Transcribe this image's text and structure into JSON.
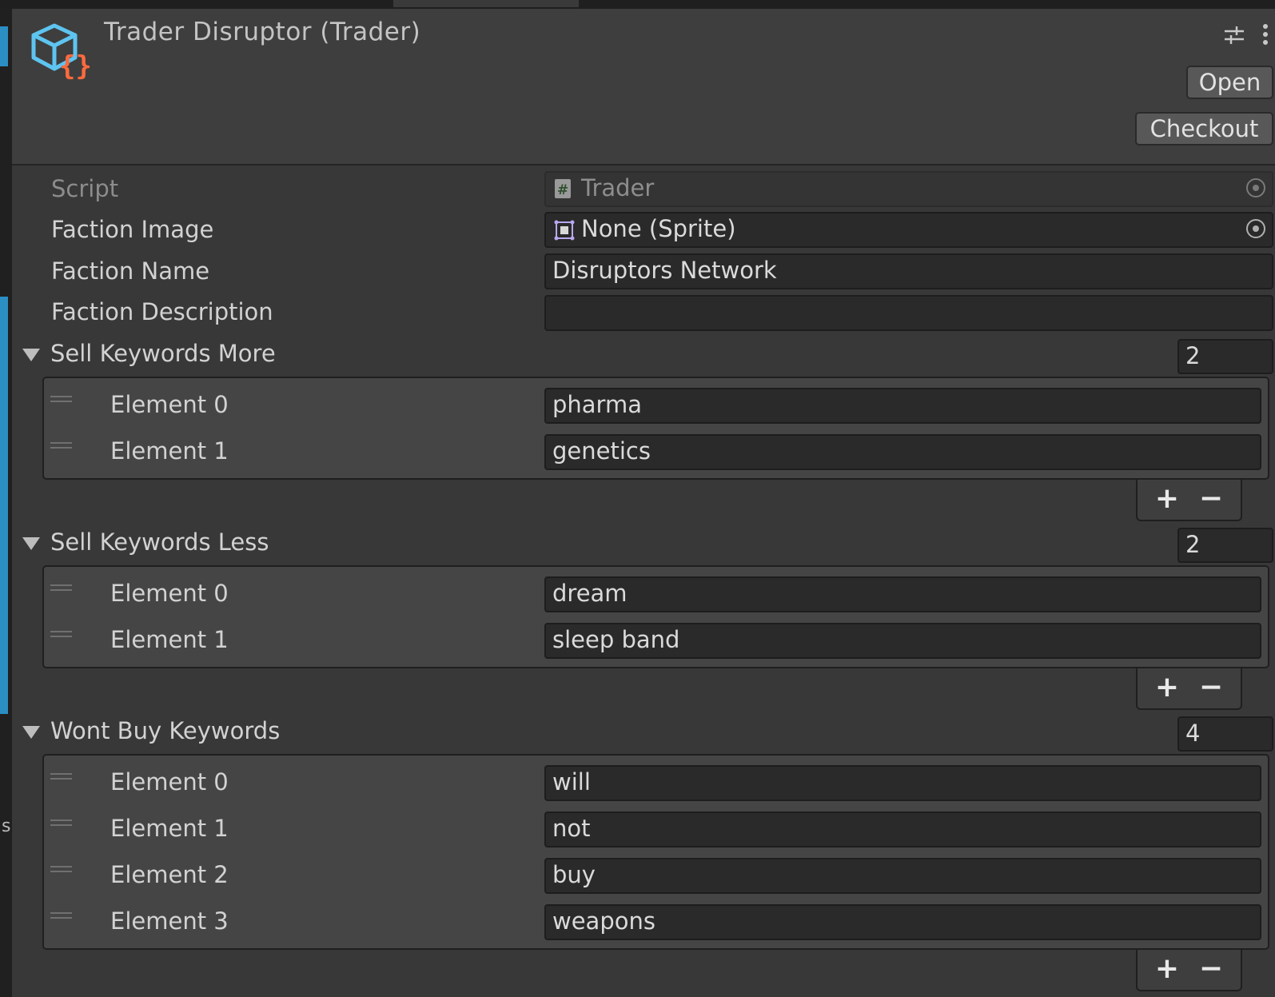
{
  "window": {
    "partial_text": "s"
  },
  "header": {
    "title": "Trader Disruptor (Trader)",
    "open_label": "Open",
    "checkout_label": "Checkout",
    "icon": "script-asset-icon",
    "settings_icon": "sliders-icon",
    "menu_icon": "kebab-menu-icon"
  },
  "properties": {
    "script": {
      "label": "Script",
      "value": "Trader"
    },
    "faction_image": {
      "label": "Faction Image",
      "value": "None (Sprite)"
    },
    "faction_name": {
      "label": "Faction Name",
      "value": "Disruptors Network"
    },
    "faction_description": {
      "label": "Faction Description",
      "value": ""
    }
  },
  "lists": [
    {
      "label": "Sell Keywords More",
      "size": "2",
      "elements": [
        {
          "label": "Element 0",
          "value": "pharma"
        },
        {
          "label": "Element 1",
          "value": "genetics"
        }
      ]
    },
    {
      "label": "Sell Keywords Less",
      "size": "2",
      "elements": [
        {
          "label": "Element 0",
          "value": "dream"
        },
        {
          "label": "Element 1",
          "value": "sleep band"
        }
      ]
    },
    {
      "label": "Wont Buy Keywords",
      "size": "4",
      "elements": [
        {
          "label": "Element 0",
          "value": "will"
        },
        {
          "label": "Element 1",
          "value": "not"
        },
        {
          "label": "Element 2",
          "value": "buy"
        },
        {
          "label": "Element 3",
          "value": "weapons"
        }
      ]
    }
  ],
  "list_controls": {
    "add": "+",
    "remove": "−"
  },
  "colors": {
    "accent_blue": "#5ec4f0",
    "accent_orange": "#ff6a3d",
    "background": "#383838",
    "field": "#2a2a2a"
  }
}
